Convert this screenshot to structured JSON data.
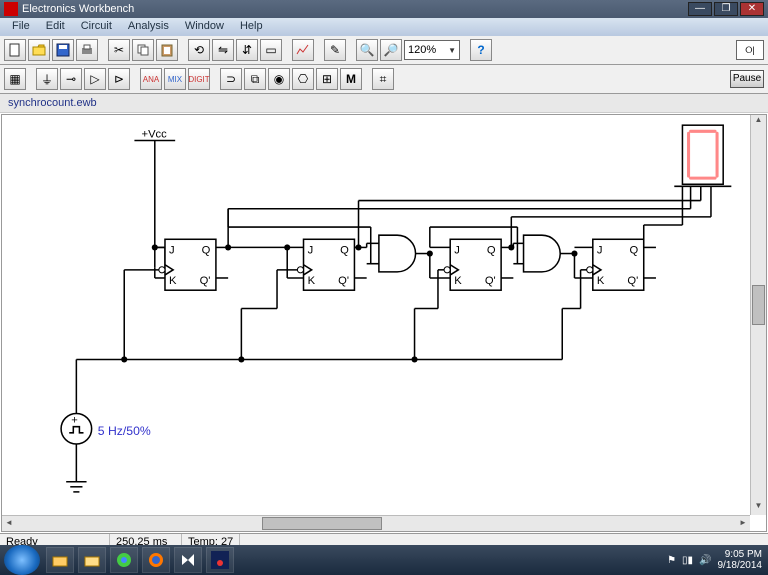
{
  "titlebar": {
    "app": "Electronics Workbench"
  },
  "menu": {
    "file": "File",
    "edit": "Edit",
    "circuit": "Circuit",
    "analysis": "Analysis",
    "window": "Window",
    "help": "Help"
  },
  "toolbar": {
    "zoom": "120%",
    "help": "?",
    "pause": "Pause"
  },
  "file": {
    "name": "synchrocount.ewb"
  },
  "status": {
    "ready": "Ready",
    "time": "250.25 ms",
    "temp": "Temp:  27"
  },
  "circuit": {
    "vcc": "+Vcc",
    "clk": "5 Hz/50%",
    "ff_labels": {
      "J": "J",
      "K": "K",
      "Q": "Q",
      "Qn": "Q'"
    },
    "display_value": "0"
  },
  "tray": {
    "time": "9:05 PM",
    "date": "9/18/2014"
  }
}
